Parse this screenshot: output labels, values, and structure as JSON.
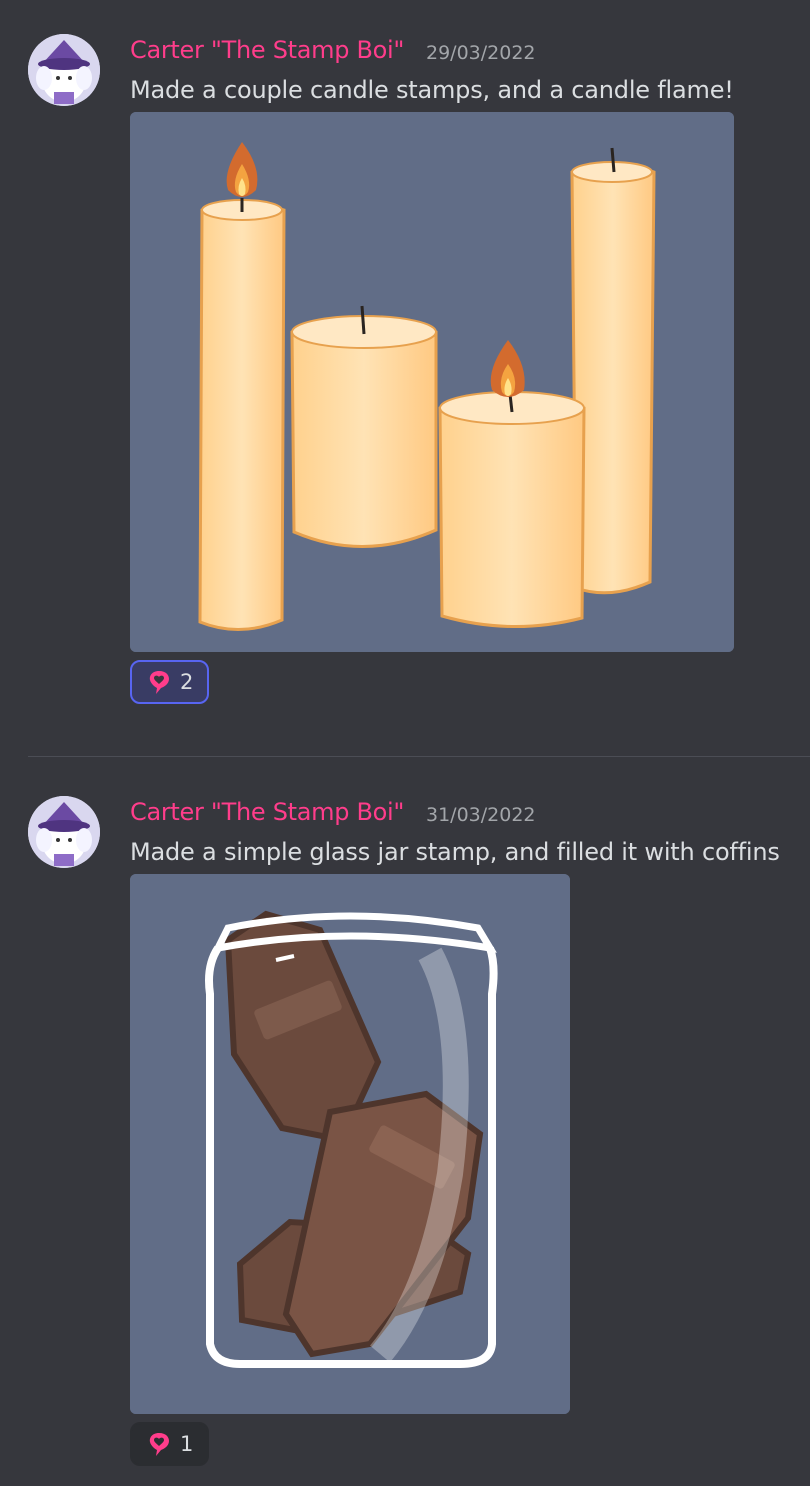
{
  "colors": {
    "background": "#36373d",
    "username": "#ff3d8b",
    "timestamp": "#a3a6aa",
    "reaction_active_border": "#5865f2",
    "heart": "#ff3d8b",
    "image_background": "#616d87"
  },
  "messages": [
    {
      "username": "Carter \"The Stamp Boi\"",
      "timestamp": "29/03/2022",
      "text": "Made a couple candle stamps, and a candle flame!",
      "reaction": {
        "icon": "heart-bubble-icon",
        "count": "2",
        "reacted": true
      }
    },
    {
      "username": "Carter \"The Stamp Boi\"",
      "timestamp": "31/03/2022",
      "text": "Made a simple glass jar stamp, and filled it with coffins",
      "reaction": {
        "icon": "heart-bubble-icon",
        "count": "1",
        "reacted": false
      }
    }
  ]
}
